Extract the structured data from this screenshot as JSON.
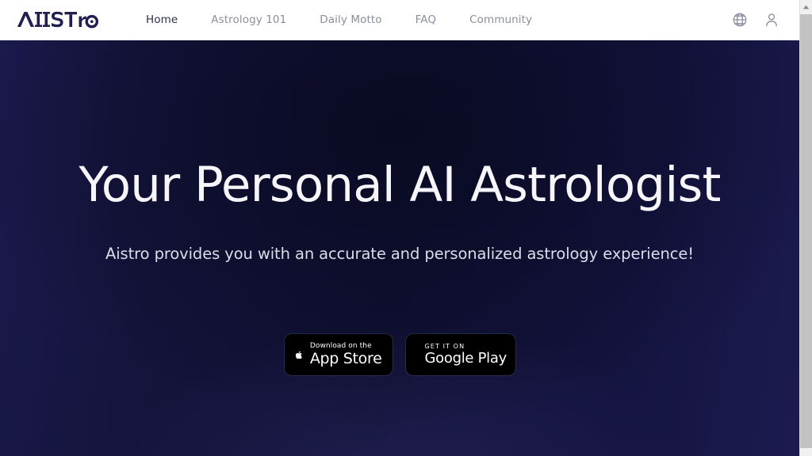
{
  "brand": {
    "logo_text": "Aistro",
    "logo_color": "#201f4e"
  },
  "nav": {
    "links": [
      {
        "label": "Home",
        "active": true
      },
      {
        "label": "Astrology 101",
        "active": false
      },
      {
        "label": "Daily Motto",
        "active": false
      },
      {
        "label": "FAQ",
        "active": false
      },
      {
        "label": "Community",
        "active": false
      }
    ],
    "icons": [
      {
        "name": "globe-icon",
        "label": "Language"
      },
      {
        "name": "user-icon",
        "label": "Account"
      }
    ]
  },
  "hero": {
    "title": "Your Personal AI Astrologist",
    "subtitle": "Aistro provides you with an accurate and personalized astrology experience!",
    "background_color": "#101134",
    "title_color": "#f5f5fa"
  },
  "store_badges": {
    "apple": {
      "icon": "apple-icon",
      "small_text": "Download on the",
      "big_text": "App Store"
    },
    "google": {
      "icon": "google-play-icon",
      "small_text": "GET IT ON",
      "big_text": "Google Play"
    }
  },
  "scrollbar": {
    "up_arrow": "▲"
  }
}
